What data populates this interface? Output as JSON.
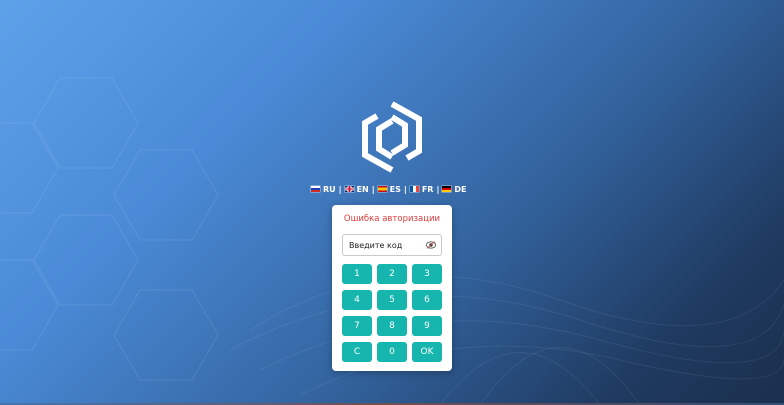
{
  "languages": [
    {
      "code": "RU",
      "flag_colors": [
        "#ffffff",
        "#1c3fb8",
        "#d52b1e"
      ]
    },
    {
      "code": "EN",
      "flag_colors": [
        "#012169",
        "#c8102e",
        "#ffffff"
      ]
    },
    {
      "code": "ES",
      "flag_colors": [
        "#c60b1e",
        "#ffc400",
        "#c60b1e"
      ]
    },
    {
      "code": "FR",
      "flag_colors": [
        "#0055a4",
        "#ffffff",
        "#ef4135"
      ]
    },
    {
      "code": "DE",
      "flag_colors": [
        "#000000",
        "#dd0000",
        "#ffce00"
      ]
    }
  ],
  "language_separator": "|",
  "login": {
    "error_message": "Ошибка авторизации",
    "code_placeholder": "Введите код",
    "code_value": "",
    "toggle_visibility_icon": "eye-icon"
  },
  "keypad": {
    "keys": [
      "1",
      "2",
      "3",
      "4",
      "5",
      "6",
      "7",
      "8",
      "9",
      "C",
      "0",
      "OK"
    ]
  },
  "colors": {
    "accent": "#16b5ae",
    "error": "#e03b3b",
    "background_start": "#5ea2ea",
    "background_end": "#1a2f4d"
  },
  "logo_icon": "hexagon-logo-icon"
}
